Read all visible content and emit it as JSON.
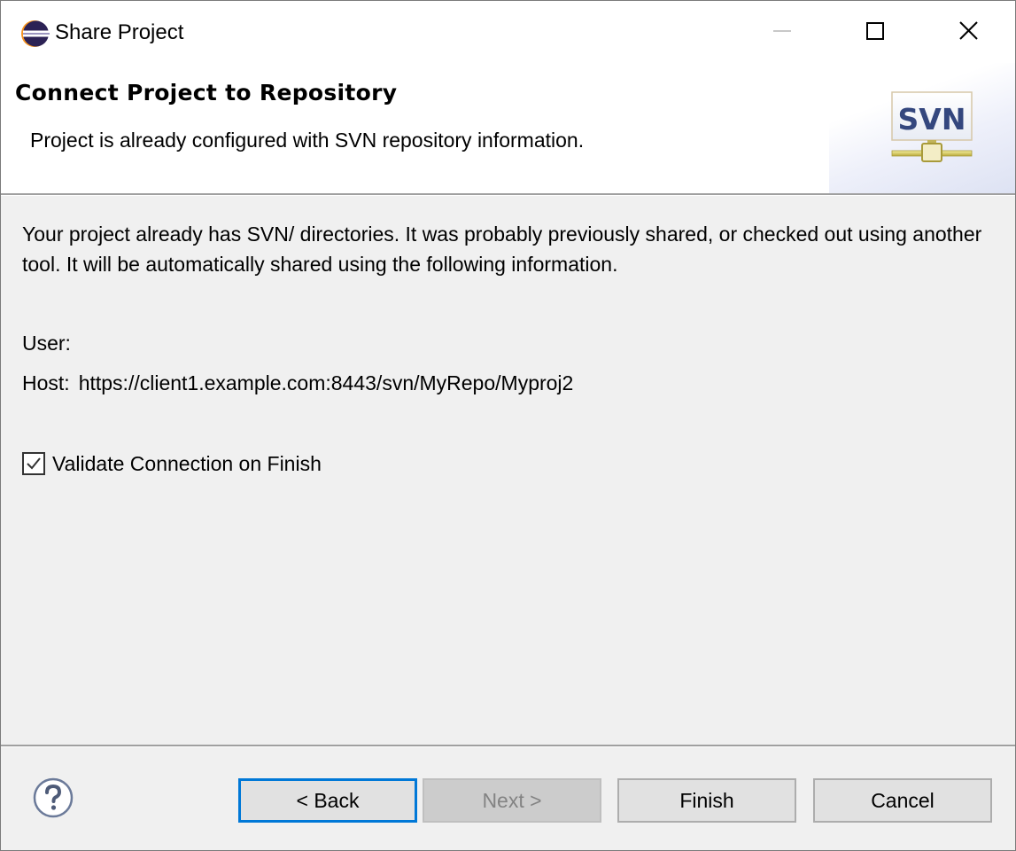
{
  "window": {
    "title": "Share Project",
    "app_icon": "eclipse-icon",
    "controls": {
      "minimize": "minimize-icon",
      "maximize": "maximize-icon",
      "close": "close-icon"
    }
  },
  "header": {
    "title": "Connect Project to Repository",
    "description": "Project is already configured with SVN repository information.",
    "logo_text": "SVN"
  },
  "body": {
    "message": "Your project already has SVN/ directories. It was probably previously shared, or checked out using another tool. It will be automatically shared using the following information.",
    "user_label": "User:",
    "user_value": "",
    "host_label": "Host:",
    "host_value": "https://client1.example.com:8443/svn/MyRepo/Myproj2",
    "validate_checkbox": {
      "label": "Validate Connection on Finish",
      "checked": true
    }
  },
  "footer": {
    "help_icon": "help-icon",
    "buttons": {
      "back": "< Back",
      "next": "Next >",
      "finish": "Finish",
      "cancel": "Cancel"
    },
    "next_enabled": false,
    "focused_button": "back"
  },
  "colors": {
    "focus_border": "#0078d7",
    "dialog_bg": "#f0f0f0",
    "button_bg": "#e1e1e1",
    "disabled_button_bg": "#cccccc"
  }
}
